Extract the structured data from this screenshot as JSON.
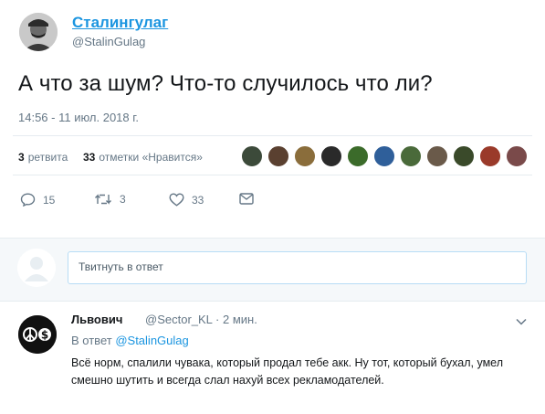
{
  "tweet": {
    "author_name": "Сталингулаг",
    "author_handle": "@StalinGulag",
    "text": "А что за шум? Что-то случилось что ли?",
    "timestamp": "14:56 - 11 июл. 2018 г."
  },
  "stats": {
    "retweets_count": "3",
    "retweets_label": "ретвита",
    "likes_count": "33",
    "likes_label": "отметки «Нравится»"
  },
  "likers_colors": [
    "#3c4a3a",
    "#5a4030",
    "#8a6d3b",
    "#2a2a2a",
    "#3b6b2a",
    "#2f5f9a",
    "#4a6a3a",
    "#6a5a4a",
    "#3a4a2a",
    "#9a3a2a",
    "#7a4a4a"
  ],
  "actions": {
    "replies": "15",
    "retweets": "3",
    "likes": "33"
  },
  "reply_box": {
    "placeholder": "Твитнуть в ответ"
  },
  "reply": {
    "author_name": "Львович",
    "author_handle": "@Sector_KL",
    "time": "· 2 мин.",
    "in_reply_prefix": "В ответ",
    "in_reply_handle": "@StalinGulag",
    "text": "Всё норм, спалили чувака, который продал тебе акк. Ну тот, который бухал, умел смешно шутить и всегда слал нахуй всех рекламодателей."
  },
  "colors": {
    "link": "#1b95e0",
    "secondary": "#657786",
    "primary": "#14171a"
  }
}
